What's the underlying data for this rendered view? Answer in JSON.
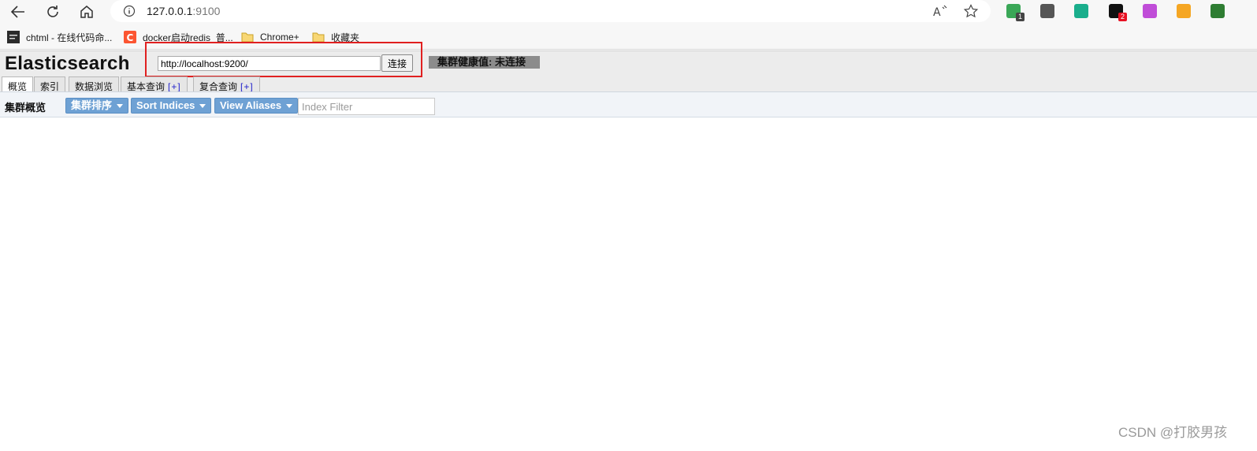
{
  "browser": {
    "url_host": "127.0.0.1",
    "url_port": ":9100"
  },
  "bookmarks": [
    {
      "label": "chtml - 在线代码命...",
      "icon": "chtml-site-icon"
    },
    {
      "label": "docker启动redis_普...",
      "icon": "csdn-site-icon"
    },
    {
      "label": "Chrome+",
      "icon": "folder-icon"
    },
    {
      "label": "收藏夹",
      "icon": "folder-icon"
    }
  ],
  "extensions": [
    {
      "icon": "shield-extension-icon",
      "badge": "1",
      "color": "#3aa757",
      "badge_color": "#444444"
    },
    {
      "icon": "collections-icon",
      "badge": "",
      "color": "#555555",
      "badge_color": ""
    },
    {
      "icon": "code-extension-icon",
      "badge": "",
      "color": "#1aae8c",
      "badge_color": ""
    },
    {
      "icon": "mask-extension-icon",
      "badge": "2",
      "color": "#111111",
      "badge_color": "#e81123"
    },
    {
      "icon": "brain-extension-icon",
      "badge": "",
      "color": "#c04dd8",
      "badge_color": ""
    },
    {
      "icon": "browser-extension-icon",
      "badge": "",
      "color": "#f5a623",
      "badge_color": ""
    },
    {
      "icon": "download-extension-icon",
      "badge": "",
      "color": "#2e7d32",
      "badge_color": ""
    }
  ],
  "app": {
    "title": "Elasticsearch",
    "connect_url": "http://localhost:9200/",
    "connect_label": "连接",
    "health_label": "集群健康值: 未连接"
  },
  "tabs": [
    {
      "label": "概览",
      "plus": ""
    },
    {
      "label": "索引",
      "plus": ""
    },
    {
      "label": "数据浏览",
      "plus": ""
    },
    {
      "label": "基本查询",
      "plus": "[+]"
    },
    {
      "label": "复合查询",
      "plus": "[+]"
    }
  ],
  "toolbar": {
    "title": "集群概览",
    "sort_cluster": "集群排序",
    "sort_indices": "Sort Indices",
    "view_aliases": "View Aliases",
    "filter_placeholder": "Index Filter"
  },
  "watermark": "CSDN @打胶男孩",
  "colors": {
    "accent_button": "#6ea1d4",
    "health_bg": "#8c8c8c",
    "highlight_box": "#e02020"
  }
}
